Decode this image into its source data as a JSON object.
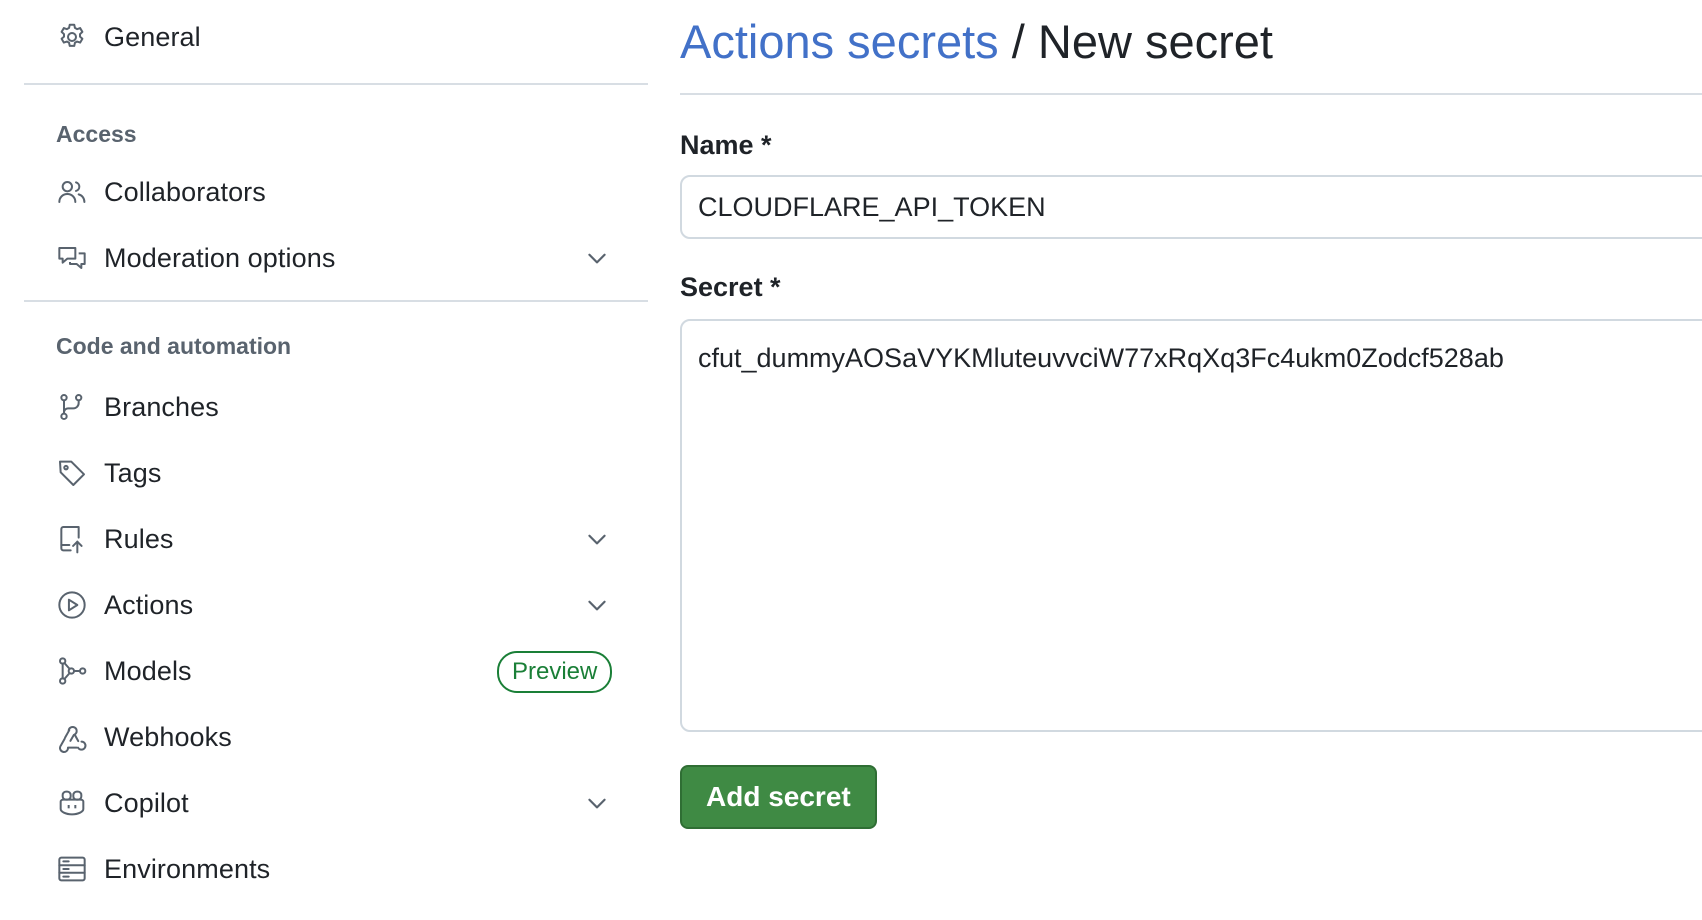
{
  "sidebar": {
    "general": {
      "label": "General",
      "icon": "gear-icon"
    },
    "sections": {
      "access": {
        "heading": "Access",
        "items": [
          {
            "label": "Collaborators",
            "icon": "people-icon"
          },
          {
            "label": "Moderation options",
            "icon": "comment-discussion-icon",
            "expandable": true
          }
        ]
      },
      "code": {
        "heading": "Code and automation",
        "items": [
          {
            "label": "Branches",
            "icon": "git-branch-icon"
          },
          {
            "label": "Tags",
            "icon": "tag-icon"
          },
          {
            "label": "Rules",
            "icon": "repo-push-icon",
            "expandable": true
          },
          {
            "label": "Actions",
            "icon": "play-icon",
            "expandable": true
          },
          {
            "label": "Models",
            "icon": "models-icon",
            "badge": "Preview"
          },
          {
            "label": "Webhooks",
            "icon": "webhook-icon"
          },
          {
            "label": "Copilot",
            "icon": "copilot-icon",
            "expandable": true
          },
          {
            "label": "Environments",
            "icon": "server-icon"
          }
        ]
      }
    }
  },
  "main": {
    "breadcrumb_link": "Actions secrets",
    "breadcrumb_separator": " / ",
    "page_title": "New secret",
    "name_field": {
      "label": "Name *",
      "value": "CLOUDFLARE_API_TOKEN"
    },
    "secret_field": {
      "label": "Secret *",
      "value": "cfut_dummyAOSaVYKMluteuvvciW77xRqXq3Fc4ukm0Zodcf528ab"
    },
    "submit_label": "Add secret"
  },
  "colors": {
    "link": "#4271c8",
    "primary_button": "#3f8a44",
    "badge_green": "#1a7f37",
    "muted": "#59636e",
    "border": "#d1d9e0"
  }
}
